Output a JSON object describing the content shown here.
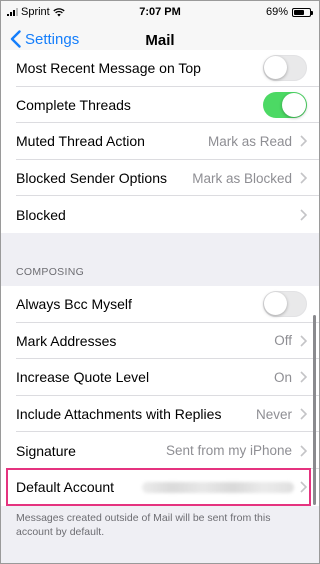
{
  "status_bar": {
    "carrier": "Sprint",
    "time": "7:07 PM",
    "battery": "69%",
    "battery_level": 0.69
  },
  "nav": {
    "back_label": "Settings",
    "title": "Mail"
  },
  "threading": [
    {
      "label": "Most Recent Message on Top",
      "control": "toggle",
      "on": false
    },
    {
      "label": "Complete Threads",
      "control": "toggle",
      "on": true
    },
    {
      "label": "Muted Thread Action",
      "value": "Mark as Read",
      "control": "chevron"
    },
    {
      "label": "Blocked Sender Options",
      "value": "Mark as Blocked",
      "control": "chevron"
    },
    {
      "label": "Blocked",
      "value": "",
      "control": "chevron"
    }
  ],
  "composing": {
    "header": "COMPOSING",
    "rows": [
      {
        "label": "Always Bcc Myself",
        "control": "toggle",
        "on": false
      },
      {
        "label": "Mark Addresses",
        "value": "Off",
        "control": "chevron"
      },
      {
        "label": "Increase Quote Level",
        "value": "On",
        "control": "chevron"
      },
      {
        "label": "Include Attachments with Replies",
        "value": "Never",
        "control": "chevron"
      },
      {
        "label": "Signature",
        "value": "Sent from my iPhone",
        "control": "chevron"
      },
      {
        "label": "Default Account",
        "value_redacted": true,
        "control": "chevron"
      }
    ],
    "footer": "Messages created outside of Mail will be sent from this account by default."
  },
  "colors": {
    "accent": "#147efb",
    "toggle_on": "#4cd964",
    "highlight": "#e5337f",
    "secondary_text": "#8e8e93",
    "background": "#efeff4"
  }
}
